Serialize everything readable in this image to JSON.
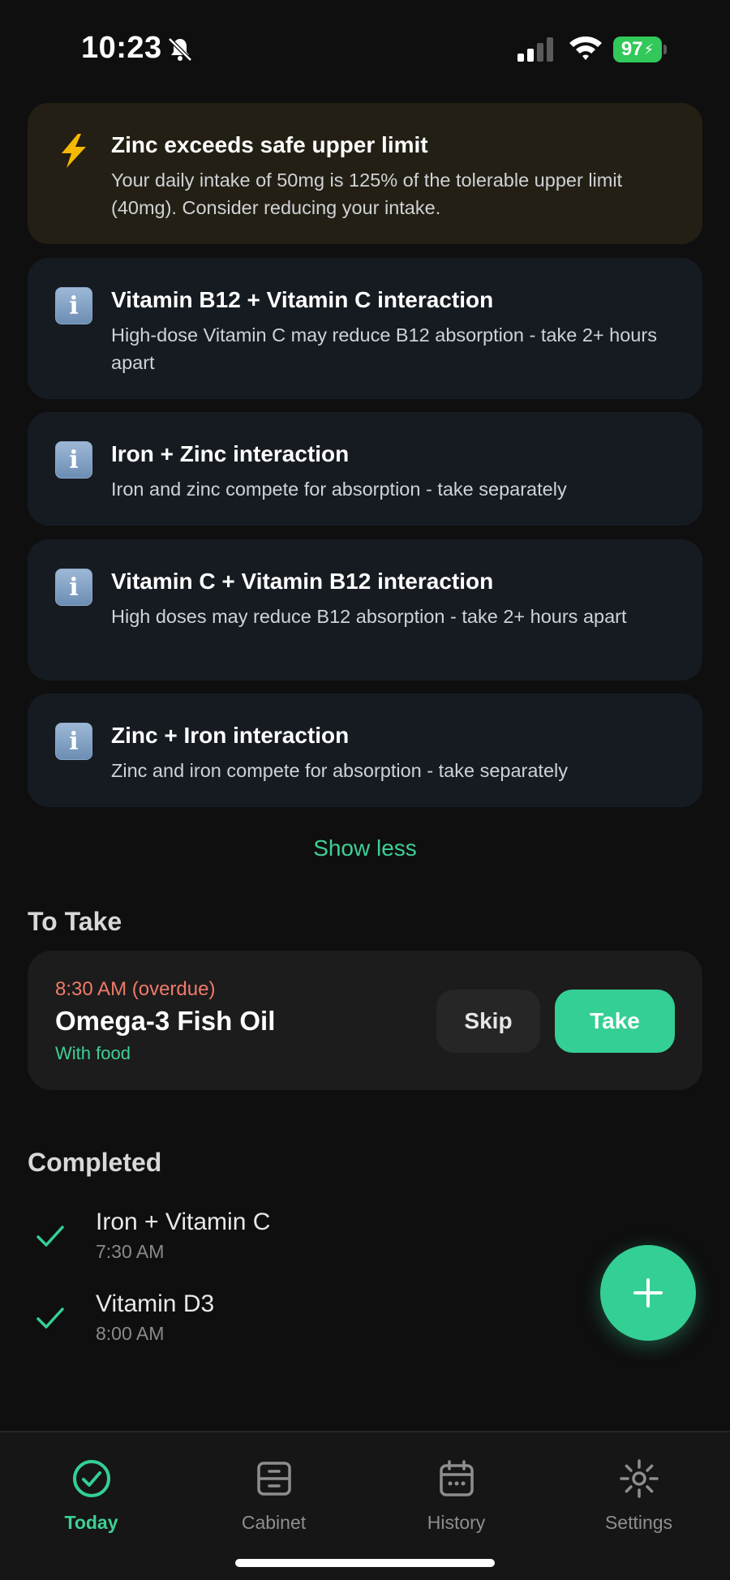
{
  "status_bar": {
    "time": "10:23",
    "battery": "97",
    "icons": [
      "bell-slash-icon",
      "cellular-signal-icon",
      "wifi-icon",
      "battery-charging-icon"
    ]
  },
  "alerts": [
    {
      "type": "warning",
      "icon": "lightning-icon",
      "title": "Zinc exceeds safe upper limit",
      "body": "Your daily intake of 50mg is 125% of the tolerable upper limit (40mg). Consider reducing your intake."
    },
    {
      "type": "info",
      "icon": "info-icon",
      "title": "Vitamin B12 + Vitamin C interaction",
      "body": "High-dose Vitamin C may reduce B12 absorption - take 2+ hours apart"
    },
    {
      "type": "info",
      "icon": "info-icon",
      "title": "Iron + Zinc interaction",
      "body": "Iron and zinc compete for absorption - take separately"
    },
    {
      "type": "info",
      "icon": "info-icon",
      "title": "Vitamin C + Vitamin B12 interaction",
      "body": "High doses may reduce B12 absorption - take 2+ hours apart"
    },
    {
      "type": "info",
      "icon": "info-icon",
      "title": "Zinc + Iron interaction",
      "body": "Zinc and iron compete for absorption - take separately"
    }
  ],
  "show_less_label": "Show less",
  "to_take": {
    "title": "To Take",
    "items": [
      {
        "time": "8:30 AM (overdue)",
        "name": "Omega-3 Fish Oil",
        "note": "With food",
        "skip_label": "Skip",
        "take_label": "Take"
      }
    ]
  },
  "completed": {
    "title": "Completed",
    "items": [
      {
        "name": "Iron + Vitamin C",
        "time": "7:30 AM"
      },
      {
        "name": "Vitamin D3",
        "time": "8:00 AM"
      }
    ]
  },
  "fab_icon": "plus-icon",
  "tabs": [
    {
      "label": "Today",
      "icon": "check-circle-icon",
      "active": true
    },
    {
      "label": "Cabinet",
      "icon": "cabinet-icon",
      "active": false
    },
    {
      "label": "History",
      "icon": "calendar-icon",
      "active": false
    },
    {
      "label": "Settings",
      "icon": "gear-icon",
      "active": false
    }
  ],
  "colors": {
    "accent": "#34cf94",
    "overdue": "#f07a6a",
    "warning_bg": "#241f14",
    "info_bg": "#161b22"
  }
}
